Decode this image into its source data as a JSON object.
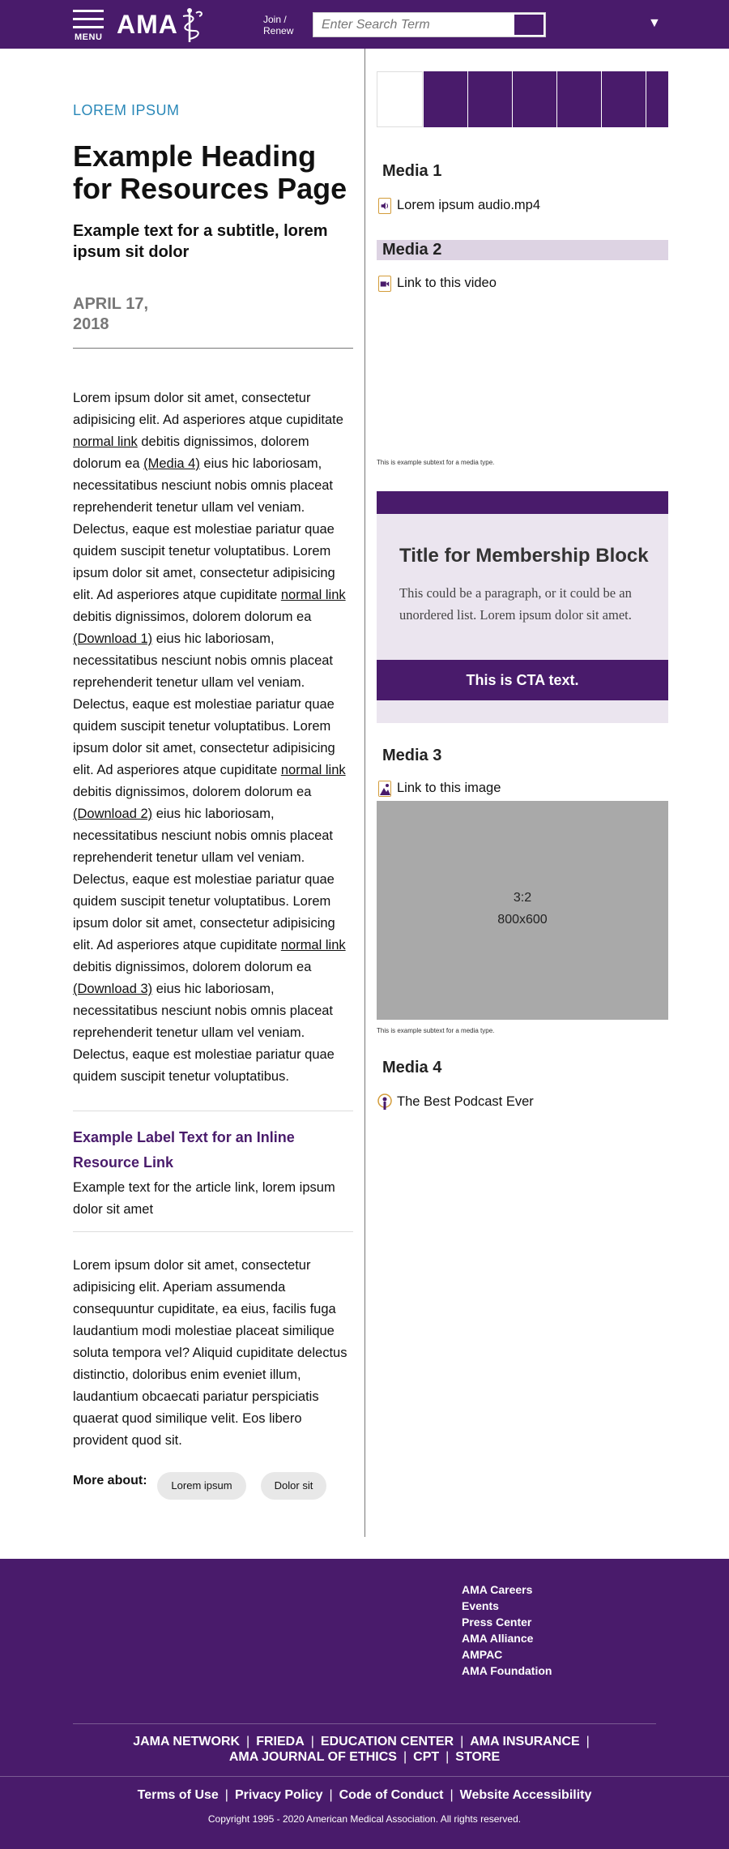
{
  "header": {
    "menu_label": "MENU",
    "logo_text": "AMA",
    "join_line1": "Join /",
    "join_line2": "Renew",
    "search_placeholder": "Enter Search Term"
  },
  "article": {
    "eyebrow": "LOREM IPSUM",
    "title": "Example Heading for Resources Page",
    "subtitle": "Example text for a subtitle, lorem ipsum sit dolor",
    "date": "APRIL 17, 2018",
    "p1": {
      "s1": "Lorem ipsum dolor sit amet, consectetur adipisicing elit. Ad asperiores atque cupiditate ",
      "link1": "normal link",
      "s2": " debitis dignissimos, dolorem dolorum ea ",
      "link2": "(Media 4)",
      "s3": " eius hic laboriosam, necessitatibus nesciunt nobis omnis placeat reprehenderit tenetur ullam vel veniam. Delectus, eaque est molestiae pariatur quae quidem suscipit tenetur voluptatibus. Lorem ipsum dolor sit amet, consectetur adipisicing elit. Ad asperiores atque cupiditate ",
      "link3": "normal link",
      "s4": " debitis dignissimos, dolorem dolorum ea ",
      "link4": "(Download 1)",
      "s5": " eius hic laboriosam, necessitatibus nesciunt nobis omnis placeat reprehenderit tenetur ullam vel veniam. Delectus, eaque est molestiae pariatur quae quidem suscipit tenetur voluptatibus. Lorem ipsum dolor sit amet, consectetur adipisicing elit. Ad asperiores atque cupiditate ",
      "link5": "normal link",
      "s6": " debitis dignissimos, dolorem dolorum ea ",
      "link6": "(Download 2)",
      "s7": " eius hic laboriosam, necessitatibus nesciunt nobis omnis placeat reprehenderit tenetur ullam vel veniam. Delectus, eaque est molestiae pariatur quae quidem suscipit tenetur voluptatibus. Lorem ipsum dolor sit amet, consectetur adipisicing elit. Ad asperiores atque cupiditate ",
      "link7": "normal link",
      "s8": " debitis dignissimos, dolorem dolorum ea ",
      "link8": "(Download 3)",
      "s9": " eius hic laboriosam, necessitatibus nesciunt nobis omnis placeat reprehenderit tenetur ullam vel veniam. Delectus, eaque est molestiae pariatur quae quidem suscipit tenetur voluptatibus."
    },
    "inline_resource": {
      "label": "Example Label Text for an Inline Resource Link",
      "description": "Example text for the article link, lorem ipsum dolor sit amet"
    },
    "p2": "Lorem ipsum dolor sit amet, consectetur adipisicing elit. Aperiam assumenda consequuntur cupiditate, ea eius, facilis fuga laudantium modi molestiae placeat similique soluta tempora vel? Aliquid cupiditate delectus distinctio, doloribus enim eveniet illum, laudantium obcaecati pariatur perspiciatis quaerat quod similique velit. Eos libero provident quod sit.",
    "more_about_label": "More about:",
    "tags": [
      "Lorem ipsum",
      "Dolor sit"
    ]
  },
  "sidebar": {
    "media1": {
      "title": "Media 1",
      "link": "Lorem ipsum audio.mp4"
    },
    "media2": {
      "title": "Media 2",
      "link": "Link to this video",
      "subtext": "This is example subtext for a media type."
    },
    "membership": {
      "title": "Title for Membership Block",
      "text": "This could be a paragraph, or it could be an unordered list. Lorem ipsum dolor sit amet.",
      "cta": "This is CTA text."
    },
    "media3": {
      "title": "Media 3",
      "link": "Link to this image",
      "placeholder_ratio": "3:2",
      "placeholder_size": "800x600",
      "subtext": "This is example subtext for a media type."
    },
    "media4": {
      "title": "Media 4",
      "link": "The Best Podcast Ever"
    }
  },
  "footer": {
    "links": [
      "AMA Careers",
      "Events",
      "Press Center",
      "AMA Alliance",
      "AMPAC",
      "AMA Foundation"
    ],
    "nav1": [
      "JAMA NETWORK",
      "FRIEDA",
      "EDUCATION CENTER",
      "AMA INSURANCE"
    ],
    "nav2": [
      "AMA JOURNAL OF ETHICS",
      "CPT",
      "STORE"
    ],
    "legal": [
      "Terms of Use",
      "Privacy Policy",
      "Code of Conduct",
      "Website Accessibility"
    ],
    "copyright": "Copyright 1995 - 2020 American Medical Association. All rights reserved."
  },
  "colors": {
    "brand_purple": "#491b6b",
    "accent_blue": "#2a88b8",
    "light_purple": "#ebe5ef",
    "band_purple": "#ddd3e3",
    "placeholder_gray": "#a9a9a9"
  }
}
